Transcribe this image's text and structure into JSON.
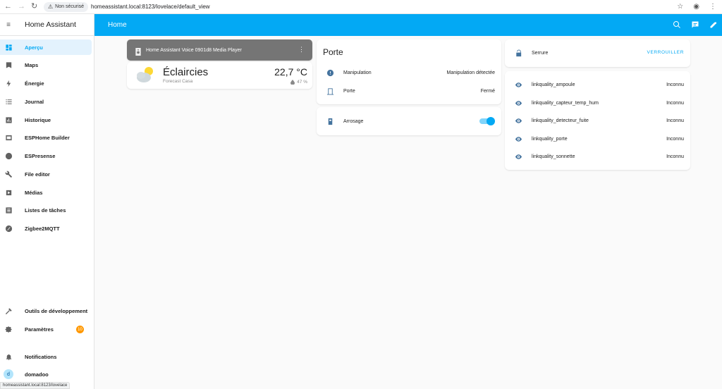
{
  "browser": {
    "security_label": "Non sécurisé",
    "url": "homeassistant.local:8123/lovelace/default_view",
    "status_url": "homeassistant.local:8123/lovelace"
  },
  "sidebar": {
    "title": "Home Assistant",
    "items": [
      {
        "label": "Aperçu",
        "icon": "dashboard-icon",
        "active": true
      },
      {
        "label": "Maps",
        "icon": "map-icon"
      },
      {
        "label": "Énergie",
        "icon": "lightning-icon"
      },
      {
        "label": "Journal",
        "icon": "list-icon"
      },
      {
        "label": "Historique",
        "icon": "chart-icon"
      },
      {
        "label": "ESPHome Builder",
        "icon": "esphome-icon"
      },
      {
        "label": "ESPresense",
        "icon": "espresense-icon"
      },
      {
        "label": "File editor",
        "icon": "wrench-icon"
      },
      {
        "label": "Médias",
        "icon": "media-icon"
      },
      {
        "label": "Listes de tâches",
        "icon": "checklist-icon"
      },
      {
        "label": "Zigbee2MQTT",
        "icon": "zigbee-icon"
      }
    ],
    "bottom_items": [
      {
        "label": "Outils de développement",
        "icon": "hammer-icon"
      },
      {
        "label": "Paramètres",
        "icon": "gear-icon",
        "badge": "10"
      }
    ],
    "notifications_label": "Notifications",
    "user": {
      "initial": "d",
      "name": "domadoo"
    }
  },
  "topbar": {
    "title": "Home"
  },
  "media_player": {
    "name": "Home Assistant Voice 0901d8 Media Player"
  },
  "weather": {
    "condition": "Éclaircies",
    "name": "Forecast Casa",
    "temperature": "22,7 °C",
    "humidity": "47 %"
  },
  "porte_card": {
    "title": "Porte",
    "rows": [
      {
        "name": "Manipulation",
        "value": "Manipulation détectée",
        "icon": "alert-circle-icon"
      },
      {
        "name": "Porte",
        "value": "Fermé",
        "icon": "door-icon"
      }
    ]
  },
  "arrosage": {
    "name": "Arrosage",
    "state_on": true
  },
  "serrure": {
    "name": "Serrure",
    "action": "VERROUILLER"
  },
  "linkquality": {
    "rows": [
      {
        "name": "linkquality_ampoule",
        "value": "Inconnu"
      },
      {
        "name": "linkquality_capteur_temp_hum",
        "value": "Inconnu"
      },
      {
        "name": "linkquality_detecteur_fuite",
        "value": "Inconnu"
      },
      {
        "name": "linkquality_porte",
        "value": "Inconnu"
      },
      {
        "name": "linkquality_sonnette",
        "value": "Inconnu"
      }
    ]
  },
  "colors": {
    "primary": "#03a9f4",
    "state_icon": "#44739e",
    "badge": "#ff9800",
    "media_card": "#757575"
  }
}
